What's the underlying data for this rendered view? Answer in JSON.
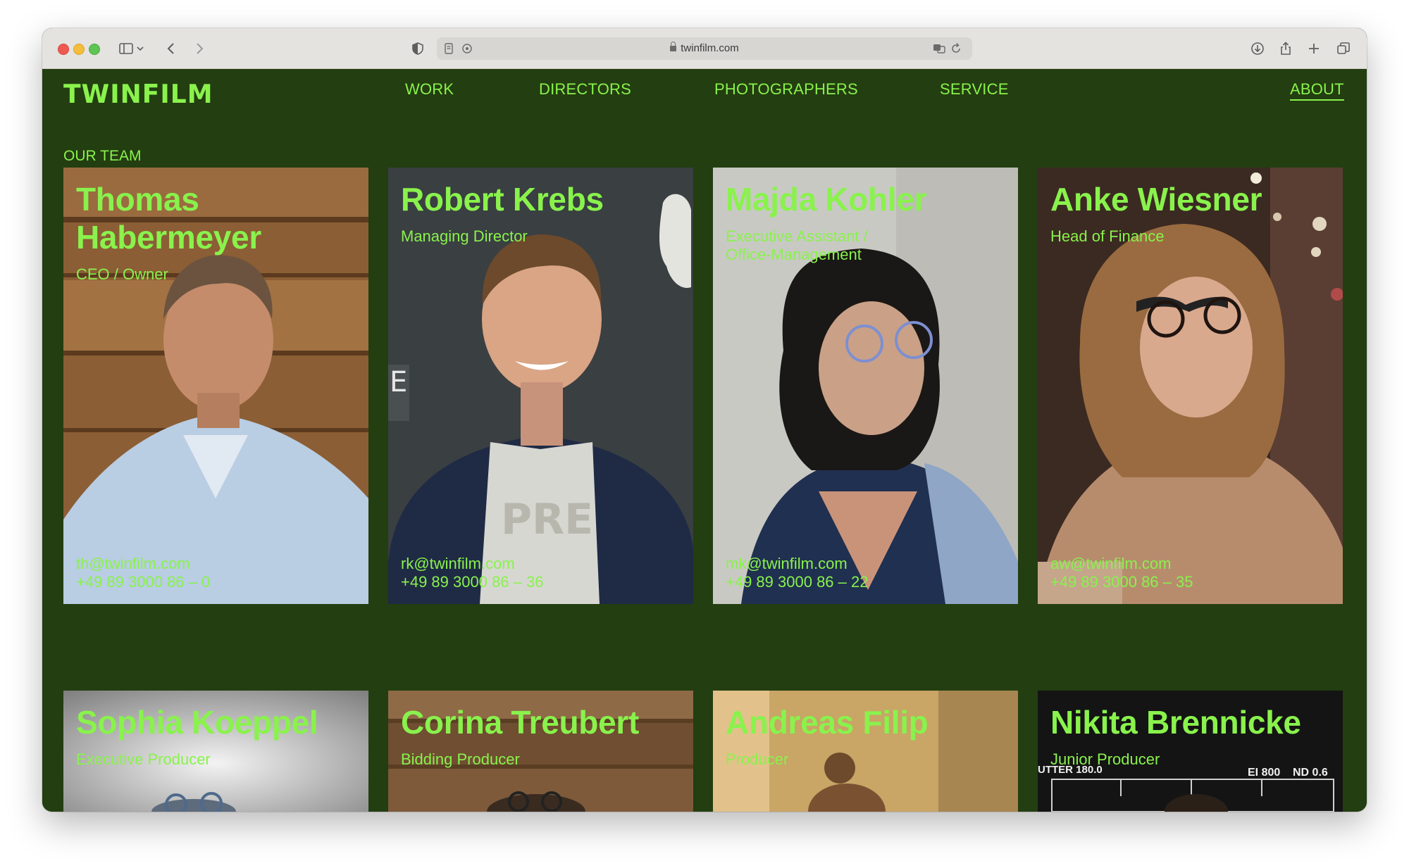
{
  "browser": {
    "url": "twinfilm.com"
  },
  "site": {
    "logo": "TWINFILM",
    "nav": {
      "work": "WORK",
      "directors": "DIRECTORS",
      "photographers": "PHOTOGRAPHERS",
      "service": "SERVICE",
      "about": "ABOUT"
    },
    "section_title": "OUR TEAM",
    "accent_color": "#89f24c",
    "background_color": "#233e10"
  },
  "team": [
    {
      "name": "Thomas Habermeyer",
      "role": "CEO / Owner",
      "email": "th@twinfilm.com",
      "phone": "+49 89 3000 86 – 0"
    },
    {
      "name": "Robert Krebs",
      "role": "Managing Director",
      "email": "rk@twinfilm.com",
      "phone": "+49 89 3000 86 – 36"
    },
    {
      "name": "Majda Kohler",
      "role": "Executive Assistant / Office-Management",
      "email": "mk@twinfilm.com",
      "phone": "+49 89 3000 86 – 22"
    },
    {
      "name": "Anke Wiesner",
      "role": "Head of Finance",
      "email": "aw@twinfilm.com",
      "phone": "+49 89 3000 86 – 35"
    },
    {
      "name": "Sophia Koeppel",
      "role": "Executive Producer"
    },
    {
      "name": "Corina Treubert",
      "role": "Bidding Producer"
    },
    {
      "name": "Andreas Filip",
      "role": "Producer"
    },
    {
      "name": "Nikita Brennicke",
      "role": "Junior Producer",
      "overlay": {
        "shutter": "UTTER 180.0",
        "ei": "EI 800",
        "nd": "ND 0.6"
      }
    }
  ]
}
